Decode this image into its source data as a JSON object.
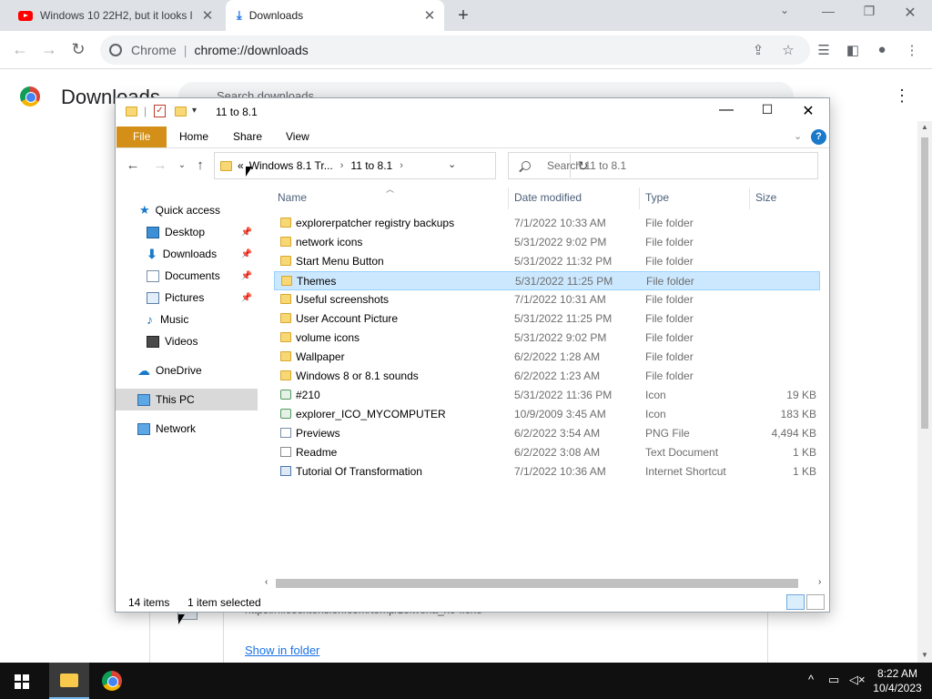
{
  "browser": {
    "tabs": [
      {
        "title": "Windows 10 22H2, but it looks l",
        "icon": "youtube-icon"
      },
      {
        "title": "Downloads",
        "icon": "download-icon"
      }
    ],
    "omnibox": {
      "site_label": "Chrome",
      "url": "chrome://downloads"
    }
  },
  "downloads_page": {
    "heading": "Downloads",
    "search_placeholder": "Search downloads",
    "item": {
      "url": "https://filesextension.com/temp/zelwena_xo-flexe",
      "show_in_folder": "Show in folder"
    }
  },
  "explorer": {
    "title": "11 to 8.1",
    "ribbon_tabs": [
      "File",
      "Home",
      "Share",
      "View"
    ],
    "breadcrumb": {
      "prefix": "«",
      "parts": [
        "Windows 8.1 Tr...",
        "11 to 8.1"
      ]
    },
    "search_placeholder": "Search 11 to 8.1",
    "columns": {
      "name": "Name",
      "date": "Date modified",
      "type": "Type",
      "size": "Size"
    },
    "nav": [
      {
        "label": "Quick access",
        "icon": "star-icon"
      },
      {
        "label": "Desktop",
        "icon": "desktop-icon",
        "pinned": true
      },
      {
        "label": "Downloads",
        "icon": "download-arrow-icon",
        "pinned": true
      },
      {
        "label": "Documents",
        "icon": "documents-icon",
        "pinned": true
      },
      {
        "label": "Pictures",
        "icon": "pictures-icon",
        "pinned": true
      },
      {
        "label": "Music",
        "icon": "music-icon"
      },
      {
        "label": "Videos",
        "icon": "videos-icon"
      },
      {
        "label": "OneDrive",
        "icon": "cloud-icon"
      },
      {
        "label": "This PC",
        "icon": "computer-icon",
        "selected": true
      },
      {
        "label": "Network",
        "icon": "network-icon"
      }
    ],
    "files": [
      {
        "name": "explorerpatcher registry backups",
        "date": "7/1/2022 10:33 AM",
        "type": "File folder",
        "size": "",
        "kind": "folder"
      },
      {
        "name": "network icons",
        "date": "5/31/2022 9:02 PM",
        "type": "File folder",
        "size": "",
        "kind": "folder"
      },
      {
        "name": "Start Menu Button",
        "date": "5/31/2022 11:32 PM",
        "type": "File folder",
        "size": "",
        "kind": "folder"
      },
      {
        "name": "Themes",
        "date": "5/31/2022 11:25 PM",
        "type": "File folder",
        "size": "",
        "kind": "folder",
        "selected": true
      },
      {
        "name": "Useful screenshots",
        "date": "7/1/2022 10:31 AM",
        "type": "File folder",
        "size": "",
        "kind": "folder"
      },
      {
        "name": "User Account Picture",
        "date": "5/31/2022 11:25 PM",
        "type": "File folder",
        "size": "",
        "kind": "folder"
      },
      {
        "name": "volume icons",
        "date": "5/31/2022 9:02 PM",
        "type": "File folder",
        "size": "",
        "kind": "folder"
      },
      {
        "name": "Wallpaper",
        "date": "6/2/2022 1:28 AM",
        "type": "File folder",
        "size": "",
        "kind": "folder"
      },
      {
        "name": "Windows 8 or 8.1 sounds",
        "date": "6/2/2022 1:23 AM",
        "type": "File folder",
        "size": "",
        "kind": "folder"
      },
      {
        "name": "#210",
        "date": "5/31/2022 11:36 PM",
        "type": "Icon",
        "size": "19 KB",
        "kind": "icon"
      },
      {
        "name": "explorer_ICO_MYCOMPUTER",
        "date": "10/9/2009 3:45 AM",
        "type": "Icon",
        "size": "183 KB",
        "kind": "icon"
      },
      {
        "name": "Previews",
        "date": "6/2/2022 3:54 AM",
        "type": "PNG File",
        "size": "4,494 KB",
        "kind": "png"
      },
      {
        "name": "Readme",
        "date": "6/2/2022 3:08 AM",
        "type": "Text Document",
        "size": "1 KB",
        "kind": "doc"
      },
      {
        "name": "Tutorial Of Transformation",
        "date": "7/1/2022 10:36 AM",
        "type": "Internet Shortcut",
        "size": "1 KB",
        "kind": "link"
      }
    ],
    "status": {
      "count": "14 items",
      "selection": "1 item selected"
    }
  },
  "taskbar": {
    "time": "8:22 AM",
    "date": "10/4/2023"
  }
}
